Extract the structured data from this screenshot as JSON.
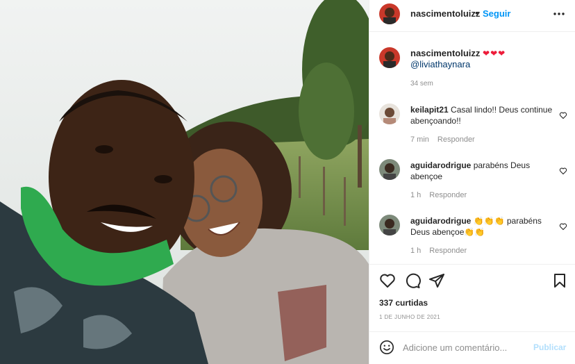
{
  "post": {
    "username": "nascimentoluizz",
    "follow_label": "Seguir",
    "header_separator": "•"
  },
  "caption": {
    "username": "nascimentoluizz",
    "hearts": "❤❤❤",
    "mention": "@liviathaynara",
    "time": "34 sem"
  },
  "comments": [
    {
      "username": "keilapit21",
      "text": "Casal lindo!! Deus continue abençoando!!",
      "time": "7 min",
      "reply": "Responder"
    },
    {
      "username": "aguidarodrigue",
      "text": "parabéns Deus abençoe",
      "time": "1 h",
      "reply": "Responder"
    },
    {
      "username": "aguidarodrigue",
      "emoji_before": "👏👏👏",
      "text": "parabéns Deus abençoe",
      "emoji_after": "👏👏",
      "time": "1 h",
      "reply": "Responder"
    }
  ],
  "likes": "337 curtidas",
  "date": "1 DE JUNHO DE 2021",
  "add_comment": {
    "placeholder": "Adicione um comentário...",
    "publish_label": "Publicar"
  },
  "colors": {
    "accent": "#0095f6",
    "mention": "#00376b",
    "muted": "#8e8e8e",
    "heart": "#ed1c3a",
    "publish_disabled": "#b2dffc"
  },
  "icons": [
    "more-options-icon",
    "heart-icon",
    "comment-icon",
    "share-icon",
    "bookmark-icon",
    "emoji-icon"
  ]
}
